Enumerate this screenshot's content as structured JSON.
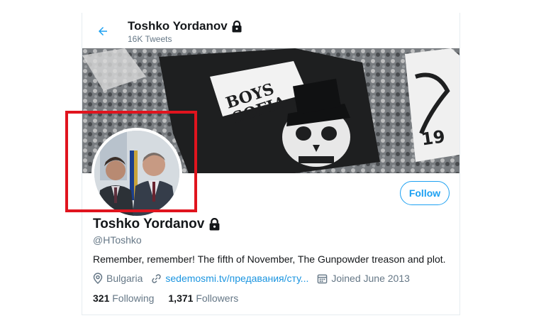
{
  "header": {
    "name": "Toshko Yordanov",
    "tweet_count": "16K Tweets",
    "back_icon": "arrow-left-icon",
    "lock_icon": "lock-icon"
  },
  "banner": {
    "flag_text_line1": "BOYS",
    "flag_text_line2": "SOFIA",
    "flag_number": "19"
  },
  "profile": {
    "follow_label": "Follow",
    "name": "Toshko Yordanov",
    "handle": "@HToshko",
    "bio": "Remember, remember! The fifth of November, The Gunpowder treason and plot.",
    "location": "Bulgaria",
    "website": "sedemosmi.tv/предавания/сту...",
    "joined": "Joined June 2013",
    "following_count": "321",
    "following_label": "Following",
    "followers_count": "1,371",
    "followers_label": "Followers"
  },
  "colors": {
    "accent": "#1da1f2",
    "link": "#1b95e0",
    "muted": "#657786",
    "highlight": "#e0141e"
  }
}
